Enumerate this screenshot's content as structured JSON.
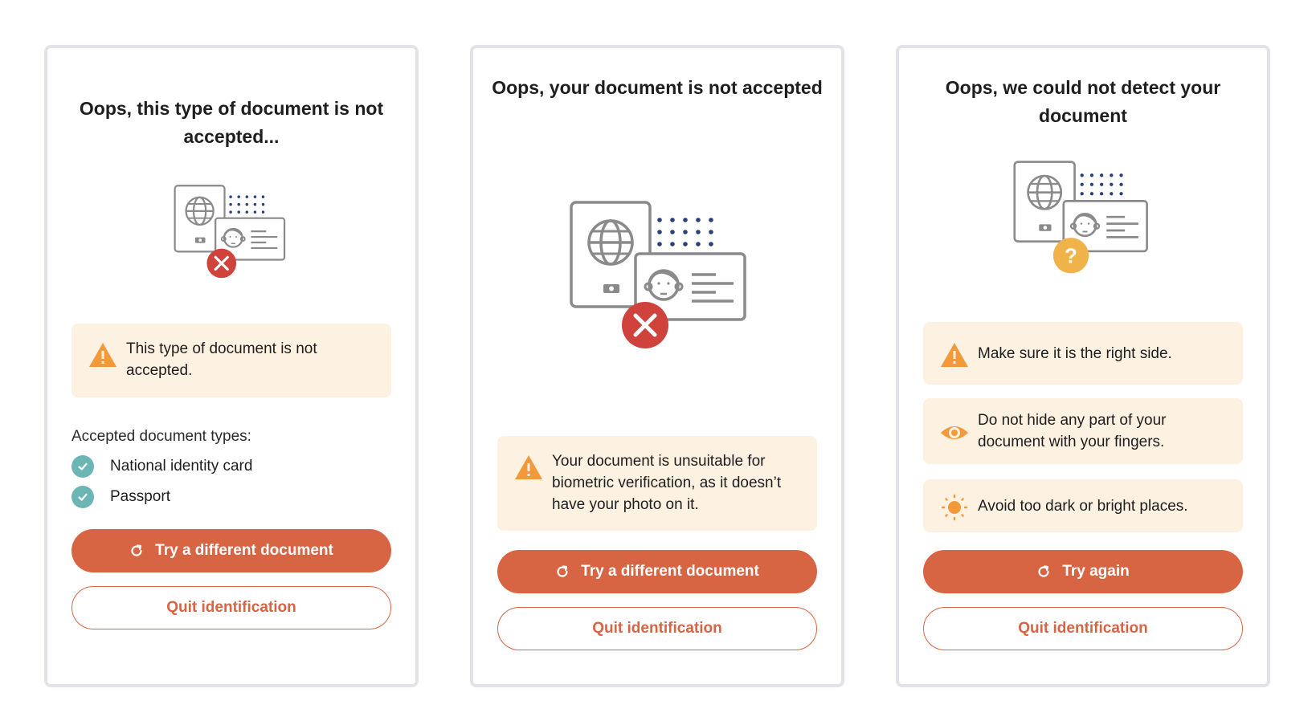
{
  "colors": {
    "primary": "#d76442",
    "alert_bg": "#fdf1e2",
    "warning": "#f29a3a",
    "error": "#d0433d",
    "unknown": "#f0b34a",
    "check": "#6bb5b5",
    "dots": "#2d3f7a",
    "illustration_stroke": "#8a8a8a",
    "card_border": "#e2e2e8"
  },
  "cards": [
    {
      "title": "Oops, this type of document is not accepted...",
      "illustration": {
        "badge": "error-x-icon"
      },
      "alert": {
        "icon": "warning-icon",
        "text": "This type of document is not accepted."
      },
      "accepted_label": "Accepted document types:",
      "accepted_types": [
        {
          "icon": "check-circle-icon",
          "label": "National identity card"
        },
        {
          "icon": "check-circle-icon",
          "label": "Passport"
        }
      ],
      "primary_button": {
        "icon": "refresh-icon",
        "label": "Try a different document"
      },
      "secondary_button": {
        "label": "Quit identification"
      }
    },
    {
      "title": "Oops, your document is not accepted",
      "illustration": {
        "badge": "error-x-icon"
      },
      "alert": {
        "icon": "warning-icon",
        "text": "Your document is unsuitable for biometric verification, as it doesn’t have your photo on it."
      },
      "primary_button": {
        "icon": "refresh-icon",
        "label": "Try a different document"
      },
      "secondary_button": {
        "label": "Quit identification"
      }
    },
    {
      "title": "Oops, we could not detect your document",
      "illustration": {
        "badge": "question-mark-icon"
      },
      "tips": [
        {
          "icon": "warning-icon",
          "text": "Make sure it is the right side."
        },
        {
          "icon": "eye-icon",
          "text": "Do not hide any part of your document with your fingers."
        },
        {
          "icon": "sun-icon",
          "text": "Avoid too dark or bright places."
        }
      ],
      "primary_button": {
        "icon": "refresh-icon",
        "label": "Try again"
      },
      "secondary_button": {
        "label": "Quit identification"
      }
    }
  ]
}
